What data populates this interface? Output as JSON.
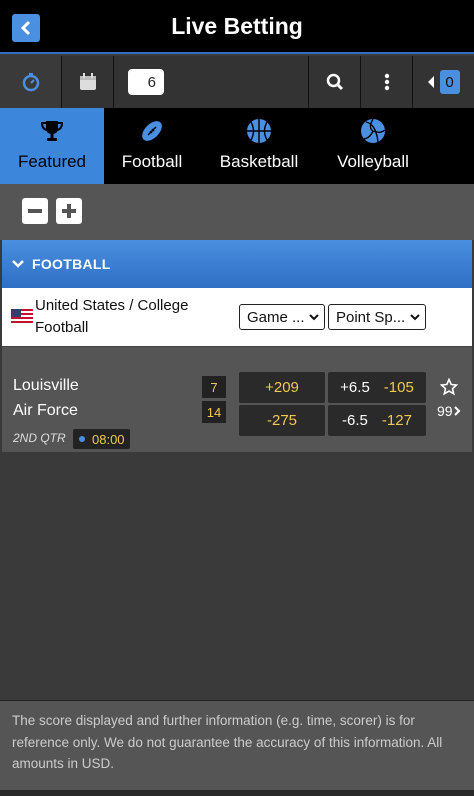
{
  "header": {
    "title": "Live Betting"
  },
  "toolbar": {
    "event_count": "6",
    "bet_slip_count": "0"
  },
  "sport_tabs": [
    {
      "label": "Featured",
      "icon": "trophy-icon",
      "active": true
    },
    {
      "label": "Football",
      "icon": "football-icon",
      "active": false
    },
    {
      "label": "Basketball",
      "icon": "basketball-icon",
      "active": false
    },
    {
      "label": "Volleyball",
      "icon": "volleyball-icon",
      "active": false
    }
  ],
  "section": {
    "title": "FOOTBALL"
  },
  "league": {
    "name": "United States / College Football",
    "market_select_1": "Game ...",
    "market_select_2": "Point Sp..."
  },
  "event": {
    "home_team": "Louisville",
    "away_team": "Air Force",
    "home_score": "7",
    "away_score": "14",
    "period": "2ND QTR",
    "clock": "08:00",
    "moneyline": [
      "+209",
      "-275"
    ],
    "spread": [
      {
        "line": "+6.5",
        "price": "-105"
      },
      {
        "line": "-6.5",
        "price": "-127"
      }
    ],
    "more_markets": "99"
  },
  "disclaimer": "The score displayed and further information (e.g. time, scorer) is for reference only. We do not guarantee the accuracy of this information. All amounts in USD.",
  "colors": {
    "accent": "#3c86dc",
    "odds_text": "#f2c94c",
    "header_bg": "#000000"
  }
}
